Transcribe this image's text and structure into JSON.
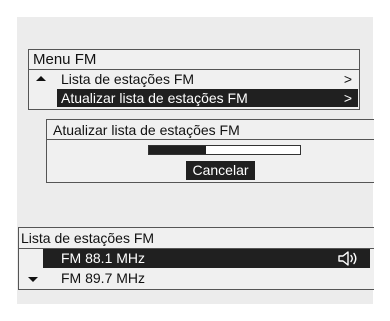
{
  "menu": {
    "title": "Menu FM",
    "items": [
      {
        "label": "Lista de estações FM",
        "chevron": ">",
        "selected": false
      },
      {
        "label": "Atualizar lista de estações FM",
        "chevron": ">",
        "selected": true
      }
    ],
    "icons": {
      "scroll_up": "scroll-up-icon"
    }
  },
  "update_dialog": {
    "title": "Atualizar lista de estações FM",
    "progress": 0.38,
    "cancel_label": "Cancelar"
  },
  "station_list": {
    "title": "Lista de estações FM",
    "stations": [
      {
        "label": "FM 88.1 MHz",
        "selected": true,
        "icon": "speaker-icon"
      },
      {
        "label": "FM 89.7 MHz",
        "selected": false
      }
    ],
    "icons": {
      "scroll_down": "scroll-down-icon"
    }
  },
  "colors": {
    "screen_background": "#ececec",
    "highlight": "#202020",
    "highlight_text": "#ffffff",
    "border": "#555555"
  }
}
